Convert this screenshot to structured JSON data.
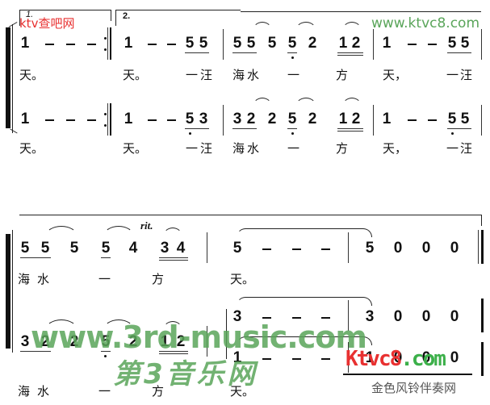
{
  "watermarks": {
    "top_left": "ktv查吧网",
    "top_right": "www.ktvc8.com",
    "center_url": "www.3rd-music.com",
    "center_cn": "第3音乐网",
    "bottom_logo": "Ktvc8.com",
    "bottom_caption": "金色风铃伴奏网"
  },
  "volta": {
    "first": "1.",
    "second": "2."
  },
  "system1": {
    "upper": {
      "notes": [
        "1",
        "–",
        "–",
        "–",
        "1",
        "–",
        "–",
        "5",
        "5",
        "5",
        "5",
        "5",
        "5",
        "2",
        "1",
        "2",
        "1",
        "–",
        "–",
        "5",
        "5"
      ],
      "lyrics": [
        "天。",
        "天。",
        "一汪",
        "海",
        "水",
        "一",
        "方",
        "天，",
        "一汪"
      ]
    },
    "lower": {
      "notes": [
        "1",
        "–",
        "–",
        "–",
        "1",
        "–",
        "–",
        "5",
        "3",
        "3",
        "2",
        "2",
        "5",
        "2",
        "1",
        "2",
        "1",
        "–",
        "–",
        "5",
        "5"
      ],
      "lyrics": [
        "天。",
        "天。",
        "一汪",
        "海",
        "水",
        "一",
        "方",
        "天，",
        "一汪"
      ]
    }
  },
  "system2": {
    "marking": "rit.",
    "upper": {
      "notes": [
        "5",
        "5",
        "5",
        "5",
        "4",
        "3",
        "4",
        "5",
        "–",
        "–",
        "–",
        "5",
        "0",
        "0",
        "0"
      ],
      "lyrics": [
        "海",
        "水",
        "一",
        "方",
        "天。"
      ]
    },
    "middle": {
      "notes": [
        "3",
        "–",
        "–",
        "–",
        "3",
        "0",
        "0",
        "0"
      ]
    },
    "lower": {
      "notes": [
        "3",
        "2",
        "2",
        "5",
        "2",
        "1",
        "2",
        "1",
        "–",
        "–",
        "–",
        "1",
        "0",
        "0",
        "0"
      ],
      "lyrics": [
        "海",
        "水",
        "一",
        "方",
        "天。"
      ]
    }
  }
}
